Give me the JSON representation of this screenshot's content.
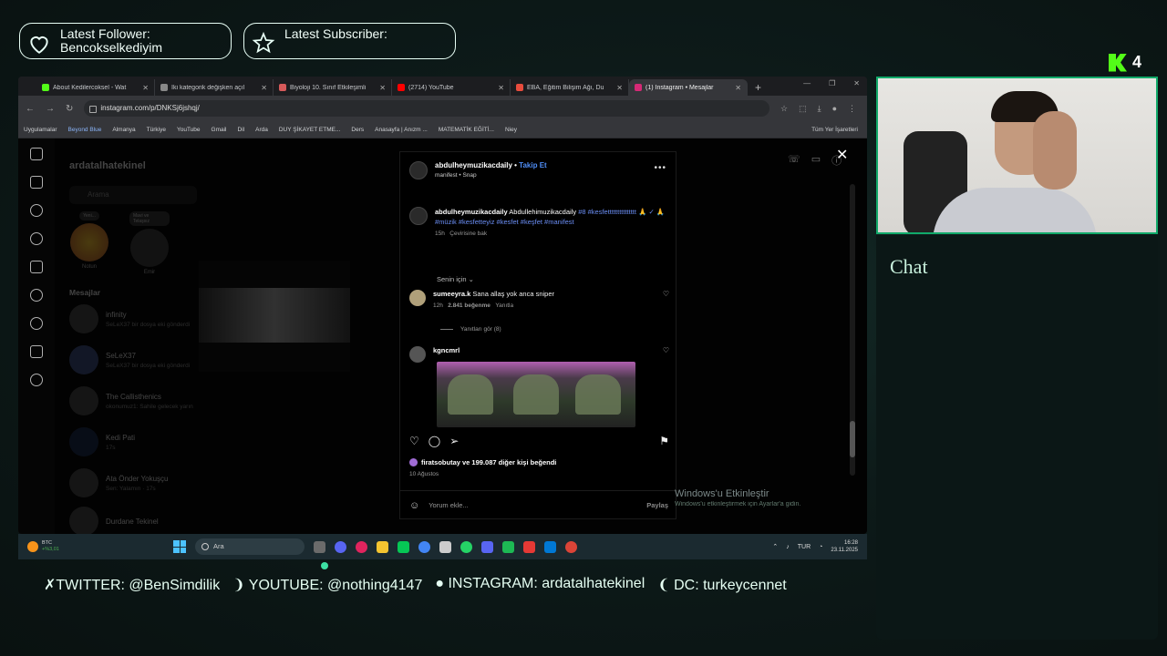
{
  "overlay": {
    "latest_follower_title": "Latest Follower:",
    "latest_follower_name": "Bencokselkediyim",
    "latest_subscriber_title": "Latest Subscriber:",
    "latest_subscriber_name": "",
    "kick_count": "4",
    "chat_title": "Chat",
    "social_twitter": "TWITTER: @BenSimdilik",
    "social_youtube": "YOUTUBE: @nothing4147",
    "social_instagram": "INSTAGRAM: ardatalhatekinel",
    "social_dc": "DC: turkeycennet"
  },
  "browser": {
    "tabs": [
      {
        "label": "About Kedilercoksel - Wat",
        "color": "#53fc18"
      },
      {
        "label": "İki kategorik değişken açıl",
        "color": "#888888"
      },
      {
        "label": "Biyoloji 10. Sınıf Etkileşimli",
        "color": "#d65a5a"
      },
      {
        "label": "(2714) YouTube",
        "color": "#ff0000"
      },
      {
        "label": "EBA, Eğitim Bilişim Ağı, Du",
        "color": "#e84c3d"
      },
      {
        "label": "(1) Instagram • Mesajlar",
        "color": "#d62976"
      }
    ],
    "url": "instagram.com/p/DNKSj6jshqj/",
    "bookmarks": [
      "Uygulamalar",
      "Beyond Blue",
      "Almanya",
      "Türkiye",
      "YouTube",
      "Gmail",
      "Dil",
      "Arda",
      "DUY ŞİKAYET ETME...",
      "Ders",
      "Anasayfa | Anızm ...",
      "MATEMATİK EĞİTİ...",
      "Niey"
    ],
    "bookmarks_all": "Tüm Yer İşaretleri"
  },
  "instagram": {
    "username": "ardatalhatekinel",
    "search_placeholder": "Arama",
    "notes": [
      {
        "bubble": "Yeni...",
        "name": "Notun"
      },
      {
        "bubble": "Mavi ve Telaşsız",
        "name": "Emir"
      },
      {
        "bubble": "R...",
        "name": "Ar"
      }
    ],
    "messages_heading": "Mesajlar",
    "conversations": [
      {
        "name": "infinity",
        "sub": "SeLeX37 bir dosya eki gönderdi"
      },
      {
        "name": "SeLeX37",
        "sub": "SeLeX37 bir dosya eki gönderdi"
      },
      {
        "name": "The Callisthenics",
        "sub": "okonumuz1: Sahile gelecek yarın"
      },
      {
        "name": "Kedi Pati",
        "sub": "17s"
      },
      {
        "name": "Ata Önder Yokuşçu",
        "sub": "Sen: Yalamın · 17s"
      },
      {
        "name": "Durdane Tekinel",
        "sub": ""
      }
    ],
    "post": {
      "author": "abdulheymuzikacdaily",
      "follow": "Takip Et",
      "subtitle": "manifest • Snap",
      "caption_author": "abdulheymuzikacdaily",
      "caption_text": "Abdullehimuzikacdaily",
      "caption_hashtags": "#8 #kesfettttttttttttttt 🙏 ✓ 🙏 #müzik #kesfetteyiz #kesfet #keşfet #manifest",
      "caption_time": "15h",
      "caption_translate": "Çevirisine bak",
      "for_you": "Senin için",
      "comment1_name": "sumeeyra.k",
      "comment1_text": "Sana allaş yok anca sniper",
      "comment1_time": "12h",
      "comment1_likes": "2.841 beğenme",
      "comment1_reply": "Yanıtla",
      "view_replies": "Yanıtları gör (8)",
      "comment2_name": "kgncmrl",
      "likes_text": "firatsobutay ve 199.087 diğer kişi beğendi",
      "date": "10 Ağustos",
      "comment_placeholder": "Yorum ekle...",
      "share": "Paylaş"
    },
    "windows_activate_title": "Windows'u Etkinleştir",
    "windows_activate_sub": "Windows'u etkinleştirmek için Ayarlar'a gidin."
  },
  "taskbar": {
    "btc_label": "BTC",
    "btc_change": "+%3,01",
    "search": "Ara",
    "lang": "TUR",
    "time": "16:28",
    "date": "23.11.2025"
  }
}
